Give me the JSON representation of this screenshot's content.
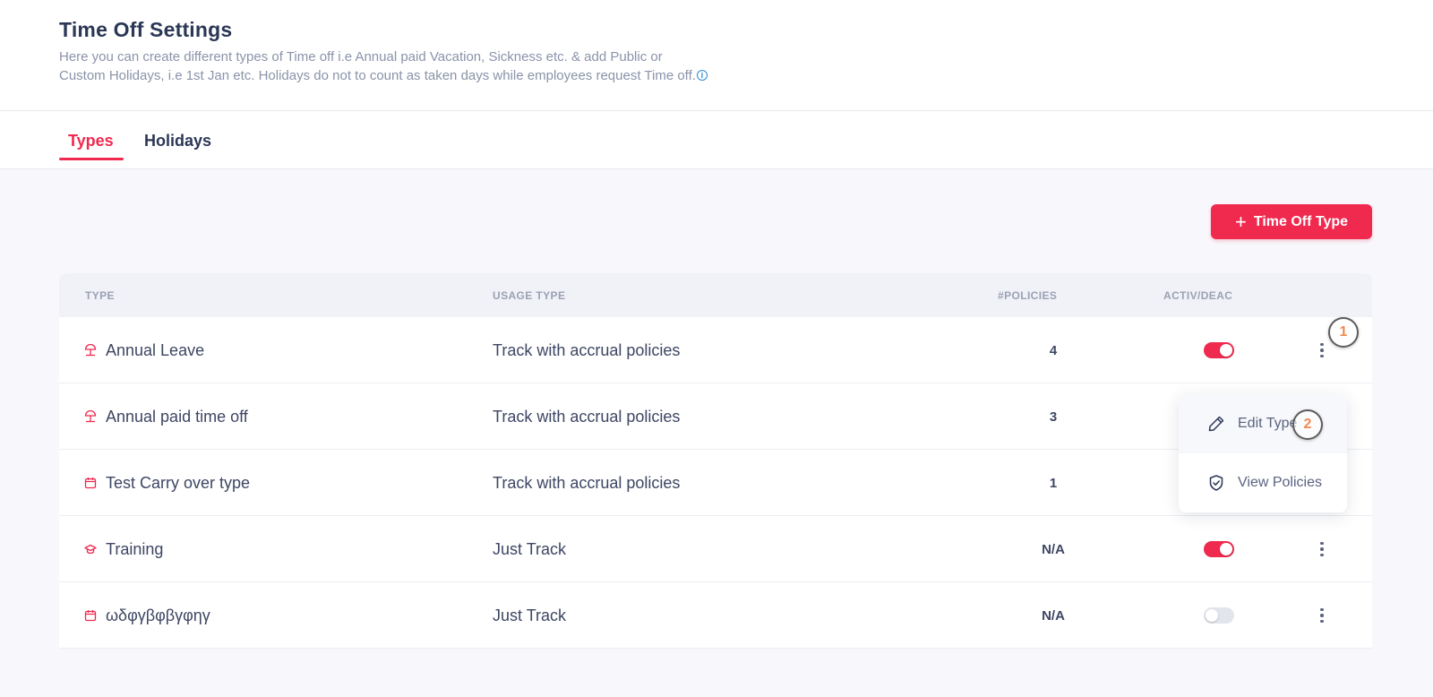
{
  "header": {
    "title": "Time Off Settings",
    "description_line1": "Here you can create different types of Time off i.e Annual paid Vacation, Sickness etc. & add Public or",
    "description_line2": "Custom Holidays, i.e 1st Jan etc. Holidays do not to count as taken days while employees request Time off.",
    "info_icon": "info-circle-icon"
  },
  "tabs": [
    {
      "label": "Types",
      "active": true
    },
    {
      "label": "Holidays",
      "active": false
    }
  ],
  "toolbar": {
    "add_label": "Time Off Type",
    "add_icon": "plus-icon"
  },
  "table": {
    "columns": [
      "TYPE",
      "USAGE TYPE",
      "#POLICIES",
      "ACTIV/DEAC"
    ],
    "rows": [
      {
        "icon": "beach-umbrella-icon",
        "type": "Annual Leave",
        "usage": "Track with accrual policies",
        "policies": "4",
        "active": true,
        "toggle_visible": true
      },
      {
        "icon": "beach-umbrella-icon",
        "type": "Annual paid time off",
        "usage": "Track with accrual policies",
        "policies": "3",
        "active": true,
        "toggle_visible": false
      },
      {
        "icon": "calendar-icon",
        "type": "Test Carry over type",
        "usage": "Track with accrual policies",
        "policies": "1",
        "active": true,
        "toggle_visible": false
      },
      {
        "icon": "graduation-cap-icon",
        "type": "Training",
        "usage": "Just Track",
        "policies": "N/A",
        "active": true,
        "toggle_visible": true
      },
      {
        "icon": "calendar-icon",
        "type": "ωδφγβφβγφηγ",
        "usage": "Just Track",
        "policies": "N/A",
        "active": false,
        "toggle_visible": true
      }
    ]
  },
  "dropdown": {
    "items": [
      {
        "label": "Edit Type",
        "icon": "pencil-icon"
      },
      {
        "label": "View Policies",
        "icon": "shield-check-icon"
      }
    ]
  },
  "annotations": [
    {
      "label": "1"
    },
    {
      "label": "2"
    }
  ],
  "colors": {
    "accent": "#f0294f",
    "title": "#2b3755",
    "muted": "#8a93a9",
    "info": "#2a8ad6",
    "badge_text": "#f08a52"
  }
}
